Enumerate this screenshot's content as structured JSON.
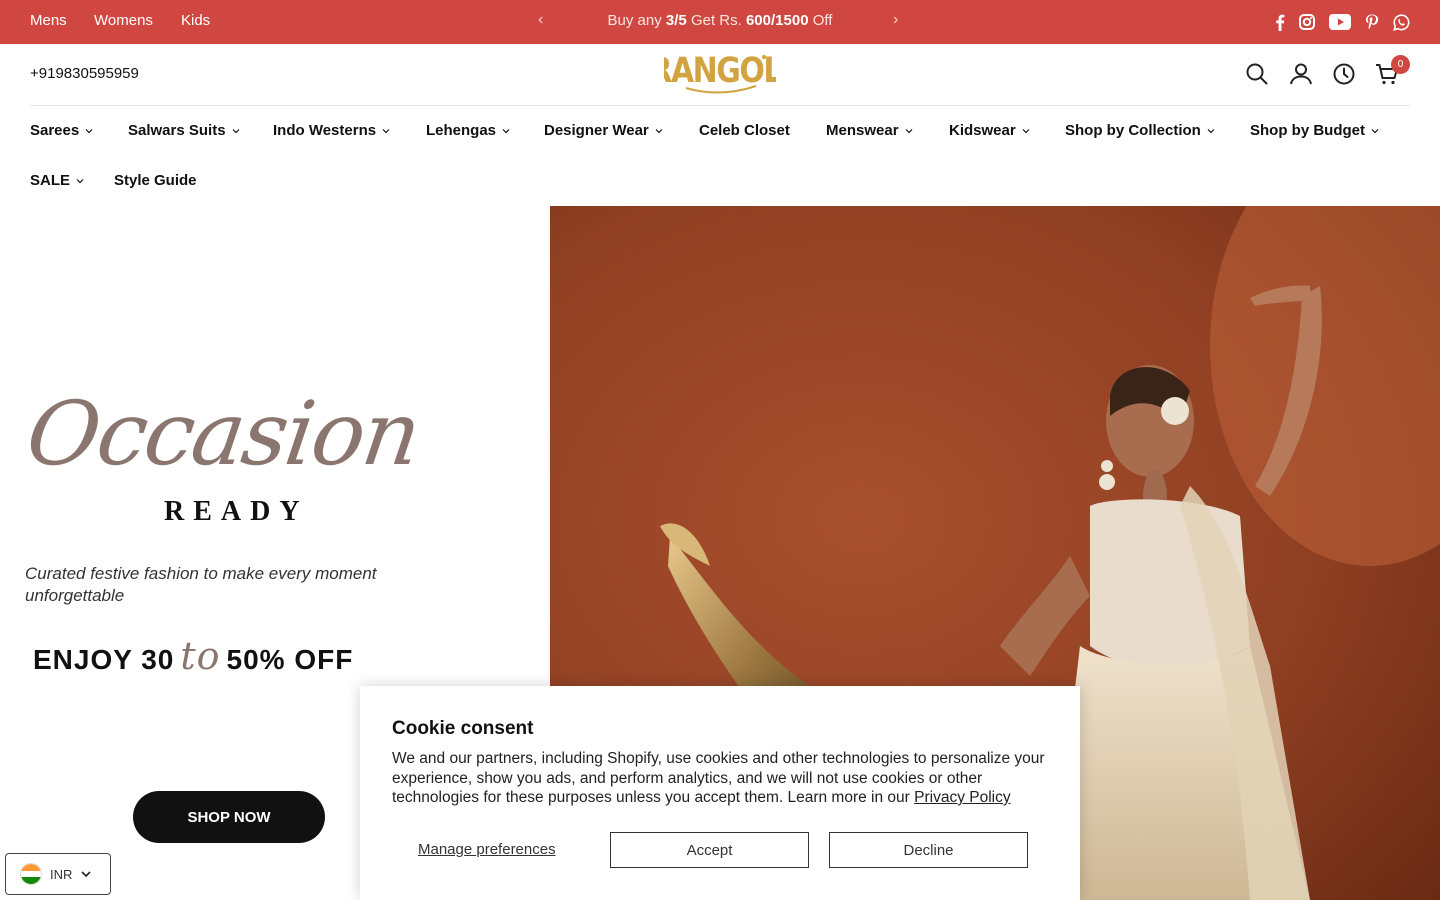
{
  "topbar": {
    "links": [
      "Mens",
      "Womens",
      "Kids"
    ],
    "promo_prefix": "Buy any ",
    "promo_qty": "3/5",
    "promo_mid": " Get Rs. ",
    "promo_amount": "600/1500",
    "promo_suffix": " Off",
    "prev_arrow": "‹",
    "next_arrow": "›",
    "social_icons": [
      "facebook-icon",
      "instagram-icon",
      "youtube-icon",
      "pinterest-icon",
      "whatsapp-icon"
    ],
    "background": "#d04741"
  },
  "header": {
    "phone": "+919830595959",
    "logo_text": "RANGOLI",
    "cart_count": "0",
    "icons": [
      "search-icon",
      "account-icon",
      "recently-viewed-icon",
      "cart-icon"
    ]
  },
  "nav": {
    "items": [
      {
        "label": "Sarees",
        "dropdown": true
      },
      {
        "label": "Salwars Suits",
        "dropdown": true
      },
      {
        "label": "Indo Westerns",
        "dropdown": true
      },
      {
        "label": "Lehengas",
        "dropdown": true
      },
      {
        "label": "Designer Wear",
        "dropdown": true
      },
      {
        "label": "Celeb Closet",
        "dropdown": false
      },
      {
        "label": "Menswear",
        "dropdown": true
      },
      {
        "label": "Kidswear",
        "dropdown": true
      },
      {
        "label": "Shop by Collection",
        "dropdown": true
      },
      {
        "label": "Shop by Budget",
        "dropdown": true
      },
      {
        "label": "SALE",
        "dropdown": true
      },
      {
        "label": "Style Guide",
        "dropdown": false
      }
    ]
  },
  "hero": {
    "script_title": "Occasion",
    "subtitle": "READY",
    "tagline": "Curated festive fashion to make every moment unforgettable",
    "offer_left": "ENJOY 30",
    "offer_to": "to",
    "offer_right": "50% OFF",
    "cta": "SHOP NOW"
  },
  "currency": {
    "code": "INR"
  },
  "cookie": {
    "title": "Cookie consent",
    "body": "We and our partners, including Shopify, use cookies and other technologies to personalize your experience, show you ads, and perform analytics, and we will not use cookies or other technologies for these purposes unless you accept them. Learn more in our ",
    "link": "Privacy Policy",
    "manage": "Manage preferences",
    "accept": "Accept",
    "decline": "Decline"
  }
}
